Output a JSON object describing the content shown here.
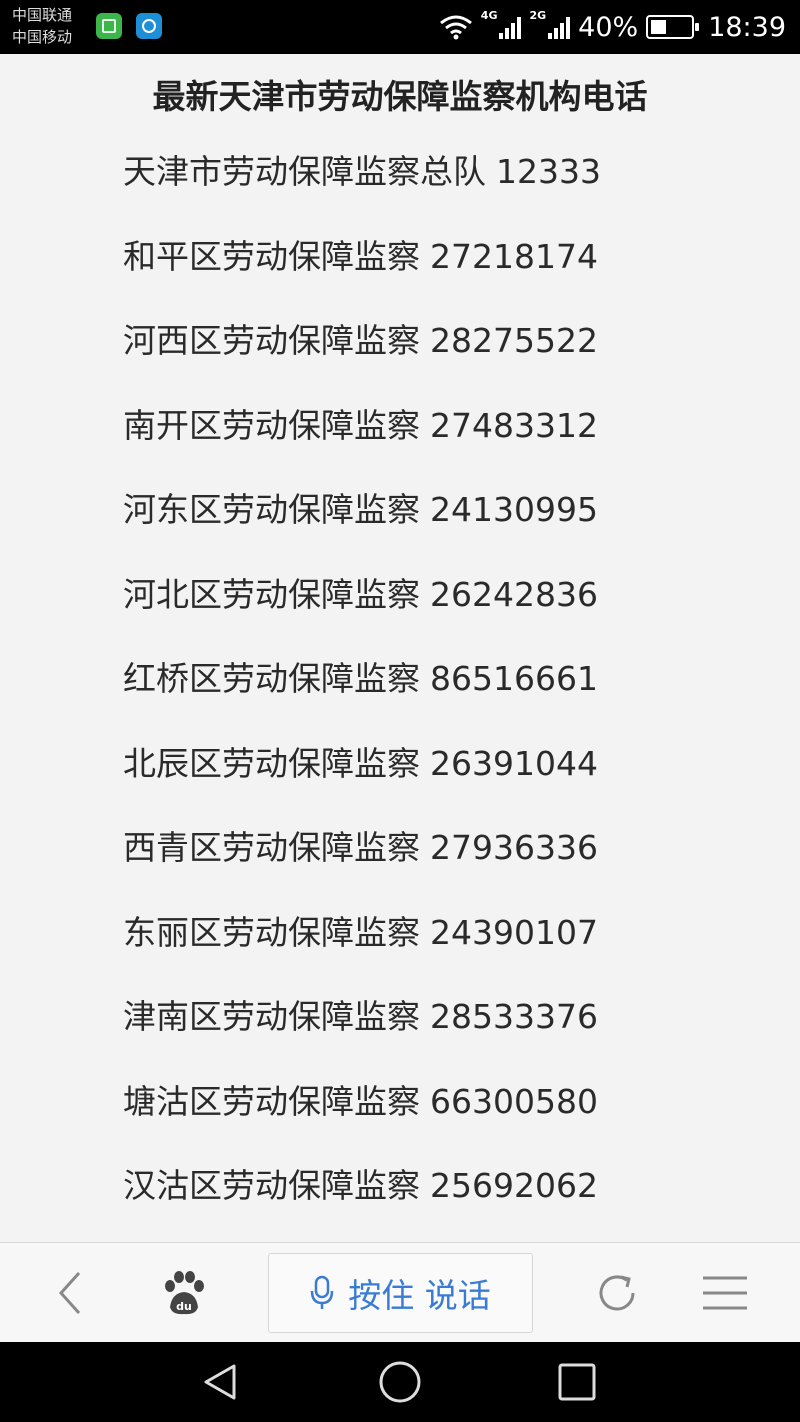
{
  "status_bar": {
    "carrier_1": "中国联通",
    "carrier_2": "中国移动",
    "network_1": "4G",
    "network_2": "2G",
    "battery_percent": "40%",
    "battery_level": 0.4,
    "time": "18:39",
    "icons": [
      "app-green-icon",
      "app-blue-icon",
      "wifi-icon",
      "signal-icon",
      "battery-icon"
    ]
  },
  "page": {
    "title": "最新天津市劳动保障监察机构电话",
    "contacts": [
      {
        "name": "天津市劳动保障监察总队",
        "phone": "12333"
      },
      {
        "name": "和平区劳动保障监察",
        "phone": "27218174"
      },
      {
        "name": "河西区劳动保障监察",
        "phone": "28275522"
      },
      {
        "name": "南开区劳动保障监察",
        "phone": "27483312"
      },
      {
        "name": "河东区劳动保障监察",
        "phone": "24130995"
      },
      {
        "name": "河北区劳动保障监察",
        "phone": "26242836"
      },
      {
        "name": "红桥区劳动保障监察",
        "phone": "86516661"
      },
      {
        "name": "北辰区劳动保障监察",
        "phone": "26391044"
      },
      {
        "name": "西青区劳动保障监察",
        "phone": "27936336"
      },
      {
        "name": "东丽区劳动保障监察",
        "phone": "24390107"
      },
      {
        "name": "津南区劳动保障监察",
        "phone": "28533376"
      },
      {
        "name": "塘沽区劳动保障监察",
        "phone": "66300580"
      },
      {
        "name": "汉沽区劳动保障监察",
        "phone": "25692062"
      }
    ]
  },
  "toolbar": {
    "voice_label": "按住 说话",
    "icons": [
      "back-icon",
      "baidu-paw-icon",
      "microphone-icon",
      "refresh-icon",
      "menu-icon"
    ]
  },
  "nav_bar": {
    "icons": [
      "nav-back-icon",
      "nav-home-icon",
      "nav-recent-icon"
    ]
  },
  "colors": {
    "accent": "#3a7bd5",
    "background": "#f3f3f3",
    "text": "#2a2a2a"
  }
}
